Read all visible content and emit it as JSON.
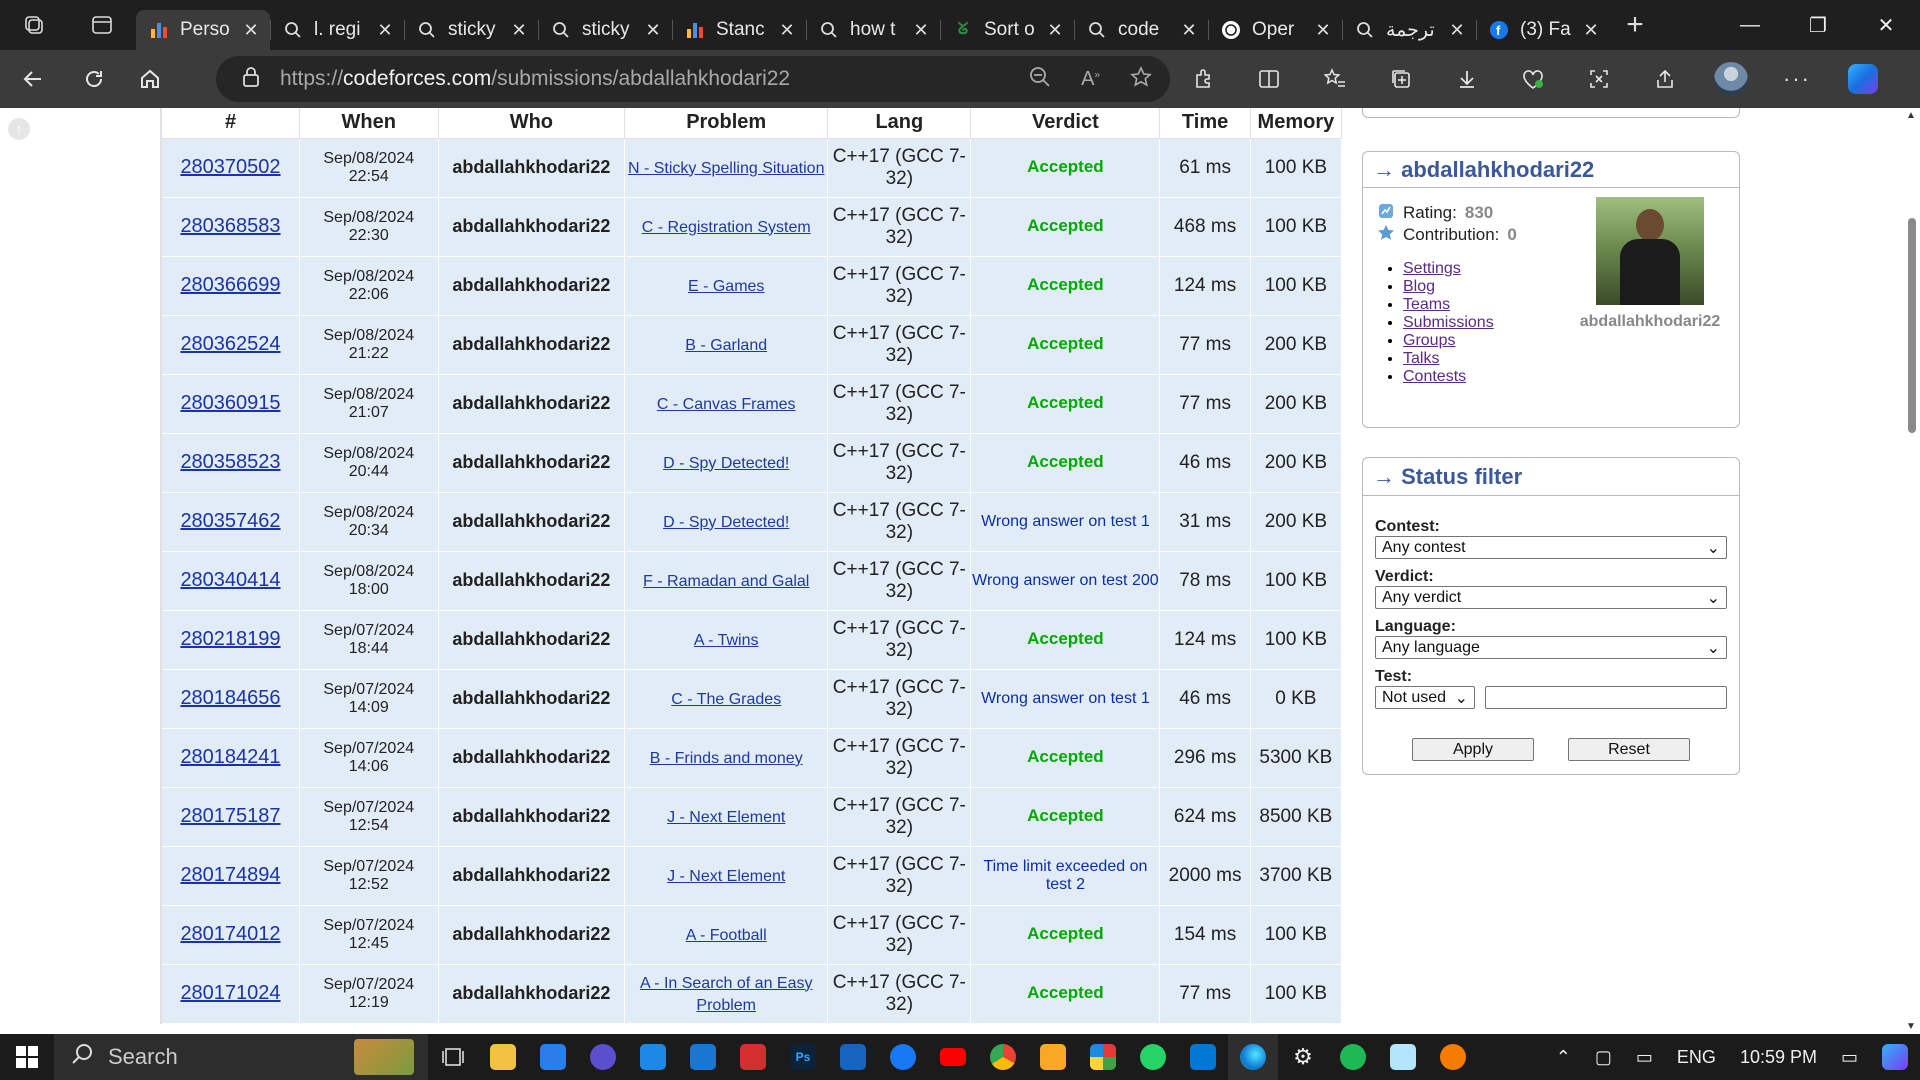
{
  "browser": {
    "tabs": [
      {
        "title": "Perso",
        "icon": "chart-icon",
        "active": true
      },
      {
        "title": "l. regi",
        "icon": "search-icon"
      },
      {
        "title": "sticky",
        "icon": "search-icon"
      },
      {
        "title": "sticky",
        "icon": "search-icon"
      },
      {
        "title": "Stanc",
        "icon": "chart-icon"
      },
      {
        "title": "how t",
        "icon": "search-icon"
      },
      {
        "title": "Sort o",
        "icon": "geeksforgeeks-icon"
      },
      {
        "title": "code",
        "icon": "search-icon"
      },
      {
        "title": "Oper",
        "icon": "openai-icon"
      },
      {
        "title": "ترجمة",
        "icon": "search-icon"
      },
      {
        "title": "(3) Fa",
        "icon": "facebook-icon"
      }
    ],
    "url_prefix": "https://",
    "url_domain": "codeforces.com",
    "url_path": "/submissions/abdallahkhodari22"
  },
  "table": {
    "headers": [
      "#",
      "When",
      "Who",
      "Problem",
      "Lang",
      "Verdict",
      "Time",
      "Memory"
    ],
    "rows": [
      {
        "id": "280370502",
        "date": "Sep/08/2024",
        "time_of_day": "22:54",
        "who": "abdallahkhodari22",
        "problem": "N - Sticky Spelling Situation",
        "lang": "C++17 (GCC 7-32)",
        "verdict": "Accepted",
        "accepted": true,
        "time": "61 ms",
        "memory": "100 KB"
      },
      {
        "id": "280368583",
        "date": "Sep/08/2024",
        "time_of_day": "22:30",
        "who": "abdallahkhodari22",
        "problem": "C - Registration System",
        "lang": "C++17 (GCC 7-32)",
        "verdict": "Accepted",
        "accepted": true,
        "time": "468 ms",
        "memory": "100 KB"
      },
      {
        "id": "280366699",
        "date": "Sep/08/2024",
        "time_of_day": "22:06",
        "who": "abdallahkhodari22",
        "problem": "E - Games",
        "lang": "C++17 (GCC 7-32)",
        "verdict": "Accepted",
        "accepted": true,
        "time": "124 ms",
        "memory": "100 KB"
      },
      {
        "id": "280362524",
        "date": "Sep/08/2024",
        "time_of_day": "21:22",
        "who": "abdallahkhodari22",
        "problem": "B - Garland",
        "lang": "C++17 (GCC 7-32)",
        "verdict": "Accepted",
        "accepted": true,
        "time": "77 ms",
        "memory": "200 KB"
      },
      {
        "id": "280360915",
        "date": "Sep/08/2024",
        "time_of_day": "21:07",
        "who": "abdallahkhodari22",
        "problem": "C - Canvas Frames",
        "lang": "C++17 (GCC 7-32)",
        "verdict": "Accepted",
        "accepted": true,
        "time": "77 ms",
        "memory": "200 KB"
      },
      {
        "id": "280358523",
        "date": "Sep/08/2024",
        "time_of_day": "20:44",
        "who": "abdallahkhodari22",
        "problem": "D - Spy Detected!",
        "lang": "C++17 (GCC 7-32)",
        "verdict": "Accepted",
        "accepted": true,
        "time": "46 ms",
        "memory": "200 KB"
      },
      {
        "id": "280357462",
        "date": "Sep/08/2024",
        "time_of_day": "20:34",
        "who": "abdallahkhodari22",
        "problem": "D - Spy Detected!",
        "lang": "C++17 (GCC 7-32)",
        "verdict": "Wrong answer on test 1",
        "accepted": false,
        "time": "31 ms",
        "memory": "200 KB"
      },
      {
        "id": "280340414",
        "date": "Sep/08/2024",
        "time_of_day": "18:00",
        "who": "abdallahkhodari22",
        "problem": "F - Ramadan and Galal",
        "lang": "C++17 (GCC 7-32)",
        "verdict": "Wrong answer on test 200",
        "accepted": false,
        "time": "78 ms",
        "memory": "100 KB"
      },
      {
        "id": "280218199",
        "date": "Sep/07/2024",
        "time_of_day": "18:44",
        "who": "abdallahkhodari22",
        "problem": "A - Twins",
        "lang": "C++17 (GCC 7-32)",
        "verdict": "Accepted",
        "accepted": true,
        "time": "124 ms",
        "memory": "100 KB"
      },
      {
        "id": "280184656",
        "date": "Sep/07/2024",
        "time_of_day": "14:09",
        "who": "abdallahkhodari22",
        "problem": "C - The Grades",
        "lang": "C++17 (GCC 7-32)",
        "verdict": "Wrong answer on test 1",
        "accepted": false,
        "time": "46 ms",
        "memory": "0 KB"
      },
      {
        "id": "280184241",
        "date": "Sep/07/2024",
        "time_of_day": "14:06",
        "who": "abdallahkhodari22",
        "problem": "B - Frinds and money",
        "lang": "C++17 (GCC 7-32)",
        "verdict": "Accepted",
        "accepted": true,
        "time": "296 ms",
        "memory": "5300 KB"
      },
      {
        "id": "280175187",
        "date": "Sep/07/2024",
        "time_of_day": "12:54",
        "who": "abdallahkhodari22",
        "problem": "J - Next Element",
        "lang": "C++17 (GCC 7-32)",
        "verdict": "Accepted",
        "accepted": true,
        "time": "624 ms",
        "memory": "8500 KB"
      },
      {
        "id": "280174894",
        "date": "Sep/07/2024",
        "time_of_day": "12:52",
        "who": "abdallahkhodari22",
        "problem": "J - Next Element",
        "lang": "C++17 (GCC 7-32)",
        "verdict": "Time limit exceeded on test 2",
        "accepted": false,
        "time": "2000 ms",
        "memory": "3700 KB"
      },
      {
        "id": "280174012",
        "date": "Sep/07/2024",
        "time_of_day": "12:45",
        "who": "abdallahkhodari22",
        "problem": "A - Football",
        "lang": "C++17 (GCC 7-32)",
        "verdict": "Accepted",
        "accepted": true,
        "time": "154 ms",
        "memory": "100 KB"
      },
      {
        "id": "280171024",
        "date": "Sep/07/2024",
        "time_of_day": "12:19",
        "who": "abdallahkhodari22",
        "problem": "A - In Search of an Easy Problem",
        "lang": "C++17 (GCC 7-32)",
        "verdict": "Accepted",
        "accepted": true,
        "time": "77 ms",
        "memory": "100 KB"
      }
    ]
  },
  "user_box": {
    "title": "→ abdallahkhodari22",
    "rating_label": "Rating:",
    "rating_value": "830",
    "contribution_label": "Contribution:",
    "contribution_value": "0",
    "links": [
      "Settings",
      "Blog",
      "Teams",
      "Submissions",
      "Groups",
      "Talks",
      "Contests"
    ],
    "avatar_name": "abdallahkhodari22"
  },
  "status_filter": {
    "title": "→ Status filter",
    "contest_label": "Contest:",
    "contest_value": "Any contest",
    "verdict_label": "Verdict:",
    "verdict_value": "Any verdict",
    "language_label": "Language:",
    "language_value": "Any language",
    "test_label": "Test:",
    "test_value": "Not used",
    "apply_label": "Apply",
    "reset_label": "Reset"
  },
  "taskbar": {
    "search_placeholder": "Search",
    "language": "ENG",
    "clock": "10:59 PM"
  },
  "colors": {
    "accepted": "#00aa00",
    "wrong": "#0b2ea8",
    "row_bg": "#e1ecf7",
    "link": "#1a33a8",
    "box_title": "#3b5998"
  }
}
